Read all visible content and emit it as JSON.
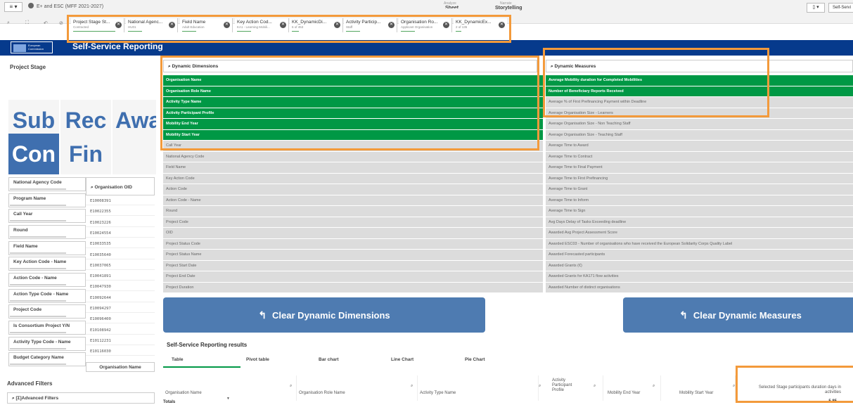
{
  "topbar": {
    "menu_label": "≡ ▾",
    "app_title": "E+ and ESC (MFF 2021-2027)",
    "nav": [
      {
        "small": "Analyze",
        "big": "Sheet"
      },
      {
        "small": "Narrate",
        "big": "Storytelling"
      }
    ],
    "bookmark_label": "▯ ▾",
    "selfservice_label": "Self-Servi"
  },
  "selections": [
    {
      "name": "Project Stage St...",
      "value": "Contracted"
    },
    {
      "name": "National Agenc...",
      "value": "HU01"
    },
    {
      "name": "Field Name",
      "value": "Adult Education"
    },
    {
      "name": "Key Action Cod...",
      "value": "KA1 - Learning Mobili..."
    },
    {
      "name": "KK_DynamicDi...",
      "value": "6 of 453"
    },
    {
      "name": "Activity Particip...",
      "value": "Staff"
    },
    {
      "name": "Organisation Ro...",
      "value": "Applicant Organisation"
    },
    {
      "name": "KK_DynamicEx...",
      "value": "2 of 135"
    }
  ],
  "header": {
    "logo_text": "European Commission",
    "title": "Self-Service Reporting"
  },
  "project_stage": {
    "title": "Project Stage",
    "tiles": [
      {
        "label": "Sub",
        "selected": false
      },
      {
        "label": "Rec",
        "selected": false
      },
      {
        "label": "Awa",
        "selected": false
      },
      {
        "label": "Con",
        "selected": true
      },
      {
        "label": "Fin",
        "selected": false
      },
      {
        "label": "",
        "selected": false
      }
    ]
  },
  "filters": [
    "National Agency Code",
    "Program Name",
    "Call Year",
    "Round",
    "Field Name",
    "Key Action Code - Name",
    "Action Code - Name",
    "Action Type Code - Name",
    "Project Code",
    "Is Consortium Project Y/N",
    "Activity Type Code - Name",
    "Budget Category Name"
  ],
  "organisation_oid": {
    "header": "Organisation OID",
    "values": [
      "E10008391",
      "E10022355",
      "E10023226",
      "E10024554",
      "E10033535",
      "E10035640",
      "E10037065",
      "E10041891",
      "E10047930",
      "E10092644",
      "E10094297",
      "E10096400",
      "E10108942",
      "E10112231",
      "E10116030"
    ],
    "column_header": "Organisation Name"
  },
  "advanced_filters": {
    "title": "Advanced Filters",
    "box_label": "[Σ]Advanced Filters"
  },
  "dimensions": {
    "search_label": "Dynamic Dimensions",
    "items": [
      {
        "label": "Organisation Name",
        "selected": true
      },
      {
        "label": "Organisation Role Name",
        "selected": true
      },
      {
        "label": "Activity Type Name",
        "selected": true
      },
      {
        "label": "Activity Participant Profile",
        "selected": true
      },
      {
        "label": "Mobility End Year",
        "selected": true
      },
      {
        "label": "Mobility Start Year",
        "selected": true
      },
      {
        "label": "Call Year",
        "selected": false
      },
      {
        "label": "National Agency Code",
        "selected": false
      },
      {
        "label": "Field Name",
        "selected": false
      },
      {
        "label": "Key Action Code",
        "selected": false
      },
      {
        "label": "Action Code",
        "selected": false
      },
      {
        "label": "Action Code - Name",
        "selected": false
      },
      {
        "label": "Round",
        "selected": false
      },
      {
        "label": "Project Code",
        "selected": false
      },
      {
        "label": "OID",
        "selected": false
      },
      {
        "label": "Project Status Code",
        "selected": false
      },
      {
        "label": "Project Status Name",
        "selected": false
      },
      {
        "label": "Project Start Date",
        "selected": false
      },
      {
        "label": "Project End Date",
        "selected": false
      },
      {
        "label": "Project Duration",
        "selected": false
      }
    ],
    "clear_label": "Clear Dynamic Dimensions"
  },
  "measures": {
    "search_label": "Dynamic Measures",
    "items": [
      {
        "label": "Average Mobility duration for Completed Mobilities",
        "selected": true
      },
      {
        "label": "Number of Beneficiary Reports Received",
        "selected": true
      },
      {
        "label": "Average % of First Prefinancing Payment within Deadline",
        "selected": false
      },
      {
        "label": "Average Organisation Size - Learners",
        "selected": false
      },
      {
        "label": "Average Organisation Size - Non Teaching Staff",
        "selected": false
      },
      {
        "label": "Average Organisation Size - Teaching Staff",
        "selected": false
      },
      {
        "label": "Average Time to Award",
        "selected": false
      },
      {
        "label": "Average Time to Contract",
        "selected": false
      },
      {
        "label": "Average Time to Final Payment",
        "selected": false
      },
      {
        "label": "Average Time to First Prefinancing",
        "selected": false
      },
      {
        "label": "Average Time to Grant",
        "selected": false
      },
      {
        "label": "Average Time to Inform",
        "selected": false
      },
      {
        "label": "Average Time to Sign",
        "selected": false
      },
      {
        "label": "Avg Days Delay of Tasks Exceeding deadline",
        "selected": false
      },
      {
        "label": "Awarded Avg Project Assessment Score",
        "selected": false
      },
      {
        "label": "Awarded ESC03 - Number of organisations who have received the European Solidarity Corps Quality Label",
        "selected": false
      },
      {
        "label": "Awarded Forecasted participants",
        "selected": false
      },
      {
        "label": "Awarded Grants (€)",
        "selected": false
      },
      {
        "label": "Awarded Grants for KA171 flow activities",
        "selected": false
      },
      {
        "label": "Awarded Number of distinct organisations",
        "selected": false
      }
    ],
    "clear_label": "Clear Dynamic Measures"
  },
  "results": {
    "title": "Self-Service Reporting results",
    "tabs": [
      "Table",
      "Pivot table",
      "Bar chart",
      "Line Chart",
      "Pie Chart"
    ],
    "columns": [
      "Organisation Name",
      "Organisation Role Name",
      "Activity Type Name",
      "Activity Participant Profile",
      "Mobility End Year",
      "Mobility Start Year",
      "Selected Stage participants duration days in activities"
    ],
    "totals_label": "Totals",
    "totals_value": "5.85"
  }
}
